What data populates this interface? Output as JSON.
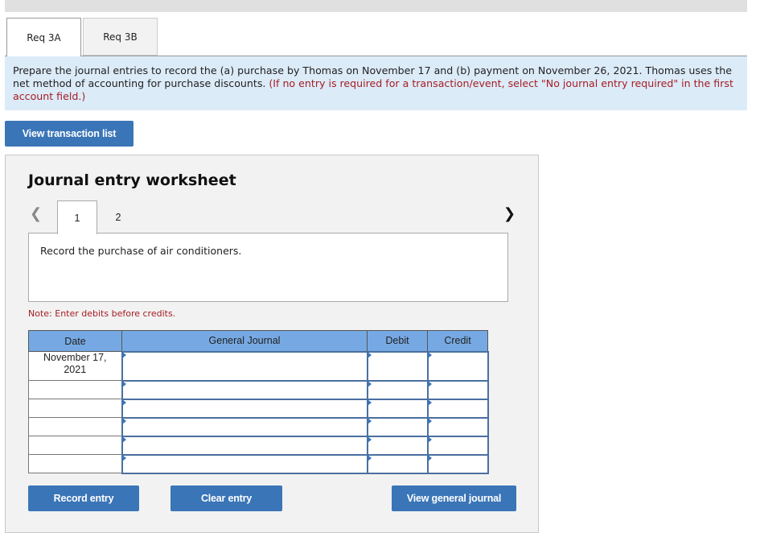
{
  "tabs": [
    {
      "label": "Req 3A",
      "active": true
    },
    {
      "label": "Req 3B",
      "active": false
    }
  ],
  "instructions": {
    "main": "Prepare the journal entries to record the (a) purchase by Thomas on November 17 and (b) payment on November 26, 2021. Thomas uses the net method of accounting for purchase discounts. ",
    "highlight": "(If no entry is required for a transaction/event, select \"No journal entry required\" in the first account field.)"
  },
  "buttons": {
    "view_transaction_list": "View transaction list",
    "record_entry": "Record entry",
    "clear_entry": "Clear entry",
    "view_general_journal": "View general journal"
  },
  "worksheet": {
    "title": "Journal entry worksheet",
    "prev_icon": "chevron-left-icon",
    "next_icon": "chevron-right-icon",
    "steps": [
      {
        "label": "1",
        "active": true
      },
      {
        "label": "2",
        "active": false
      }
    ],
    "description": "Record the purchase of air conditioners.",
    "note": "Note: Enter debits before credits."
  },
  "journal": {
    "headers": {
      "date": "Date",
      "general_journal": "General Journal",
      "debit": "Debit",
      "credit": "Credit"
    },
    "rows": [
      {
        "date_line1": "November 17,",
        "date_line2": "2021",
        "account": "",
        "debit": "",
        "credit": ""
      },
      {
        "date_line1": "",
        "date_line2": "",
        "account": "",
        "debit": "",
        "credit": ""
      },
      {
        "date_line1": "",
        "date_line2": "",
        "account": "",
        "debit": "",
        "credit": ""
      },
      {
        "date_line1": "",
        "date_line2": "",
        "account": "",
        "debit": "",
        "credit": ""
      },
      {
        "date_line1": "",
        "date_line2": "",
        "account": "",
        "debit": "",
        "credit": ""
      },
      {
        "date_line1": "",
        "date_line2": "",
        "account": "",
        "debit": "",
        "credit": ""
      }
    ]
  }
}
